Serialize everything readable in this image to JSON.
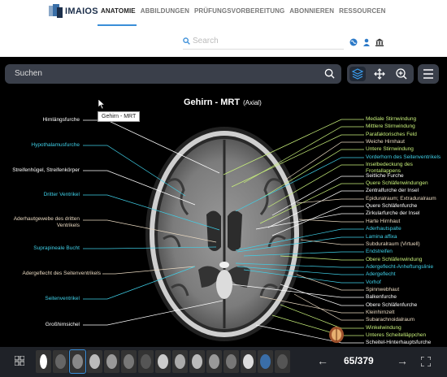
{
  "brand": {
    "name": "IMAIOS"
  },
  "nav": [
    "ANATOMIE",
    "ABBILDUNGEN",
    "PRÜFUNGSVORBEREITUNG",
    "ABONNIEREN",
    "RESSOURCEN"
  ],
  "topsearch": {
    "placeholder": "Search"
  },
  "viewer_search": {
    "placeholder": "Suchen"
  },
  "tooltip": "Gehirn - MRT",
  "image": {
    "title": "Gehirn - MRT",
    "subtitle": "(Axial)"
  },
  "left_labels": [
    {
      "text": "Hirnlängsfurche",
      "color": "#ffffff"
    },
    {
      "text": "Hypothalamusfurche",
      "color": "#3fd0e8"
    },
    {
      "text": "Streifenhügel, Streifenkörper",
      "color": "#ffffff"
    },
    {
      "text": "Dritter Ventrikel",
      "color": "#3fd0e8"
    },
    {
      "text": "Aderhautgewebe des dritten",
      "color": "#e8d8c0"
    },
    {
      "text": "Ventrikels",
      "color": "#e8d8c0"
    },
    {
      "text": "Suprapineale Bucht",
      "color": "#3fd0e8"
    },
    {
      "text": "Adergeflecht des Seitenventrikels",
      "color": "#e8d8c0"
    },
    {
      "text": "Seitenventrikel",
      "color": "#3fd0e8"
    },
    {
      "text": "Großhirnsichel",
      "color": "#ffffff"
    }
  ],
  "right_labels": [
    {
      "text": "Mediale Stirnwindung",
      "color": "#c8f07a"
    },
    {
      "text": "Mittlere Stirnwindung",
      "color": "#c8f07a"
    },
    {
      "text": "Parafaktorisches Feld",
      "color": "#c8f07a"
    },
    {
      "text": "Weiche Hirnhaut",
      "color": "#e8d8c0"
    },
    {
      "text": "Untere Stirnwindung",
      "color": "#c8f07a"
    },
    {
      "text": "Vorderhorn des Seitenventrikels",
      "color": "#3fd0e8"
    },
    {
      "text": "Inselbedeckung des",
      "color": "#c8f07a"
    },
    {
      "text": "Frontallappens",
      "color": "#c8f07a"
    },
    {
      "text": "Seitliche Furche",
      "color": "#ffffff"
    },
    {
      "text": "Quere Schläfenwindungen",
      "color": "#c8f07a"
    },
    {
      "text": "Zentralfurche der Insel",
      "color": "#ffffff"
    },
    {
      "text": "Epiduralraum; Extraduralraum",
      "color": "#e8d8c0"
    },
    {
      "text": "Quere Schläfenfurche",
      "color": "#ffffff"
    },
    {
      "text": "Zirkularfurche der Insel",
      "color": "#ffffff"
    },
    {
      "text": "Harte Hirnhaut",
      "color": "#e8d8c0"
    },
    {
      "text": "Aderhautspalte",
      "color": "#3fd0e8"
    },
    {
      "text": "Lamina affixa",
      "color": "#3fd0e8"
    },
    {
      "text": "Subduralraum (Virtuell)",
      "color": "#e8d8c0"
    },
    {
      "text": "Endstreifen",
      "color": "#3fd0e8"
    },
    {
      "text": "Obere Schläfenwindung",
      "color": "#c8f07a"
    },
    {
      "text": "Adergeflecht-Anheftungslinie",
      "color": "#3fd0e8"
    },
    {
      "text": "Adergeflecht",
      "color": "#3fd0e8"
    },
    {
      "text": "Vorhof",
      "color": "#3fd0e8"
    },
    {
      "text": "Spinnwebhaut",
      "color": "#e8d8c0"
    },
    {
      "text": "Balkenfurche",
      "color": "#ffffff"
    },
    {
      "text": "Obere Schläfenfurche",
      "color": "#ffffff"
    },
    {
      "text": "Kleinhirnzelt",
      "color": "#e8d8c0"
    },
    {
      "text": "Subarachnoidalraum",
      "color": "#e8d8c0"
    },
    {
      "text": "Winkelwindung",
      "color": "#c8f07a"
    },
    {
      "text": "Unteres Scheitelläppchen",
      "color": "#c8f07a"
    },
    {
      "text": "Scheitel-Hinterhauptsfurche",
      "color": "#ffffff"
    }
  ],
  "pager": {
    "text": "65/379"
  },
  "colors": {
    "accent": "#3a8ed8",
    "toolbar": "#3a3f4a",
    "bottombar": "#1f2228"
  }
}
